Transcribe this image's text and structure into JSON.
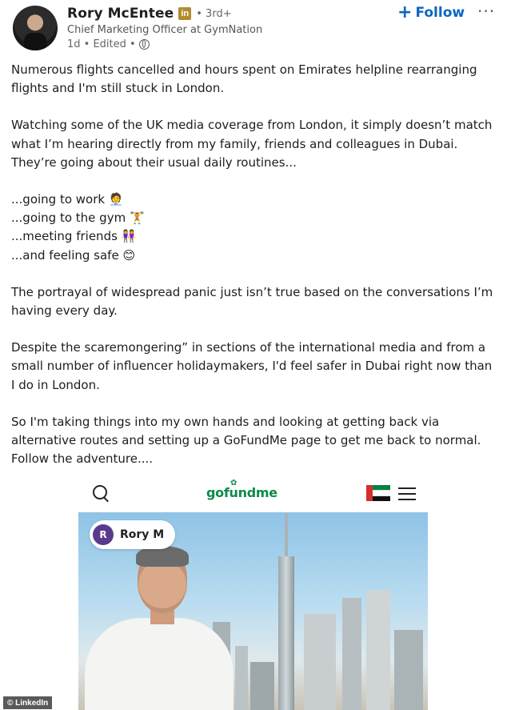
{
  "author": {
    "name": "Rory McEntee",
    "badge": "in",
    "degree": "• 3rd+",
    "headline": "Chief Marketing Officer at GymNation",
    "meta": "1d • Edited •"
  },
  "actions": {
    "follow_label": "Follow",
    "more_label": "···"
  },
  "post": {
    "p1": "Numerous flights cancelled and hours spent on Emirates helpline rearranging flights and I'm still stuck in London.",
    "p2": "Watching some of the UK media coverage from London, it simply doesn’t match what I’m hearing directly from my family, friends and colleagues in Dubai. They’re going about their usual daily routines...",
    "list": [
      "...going to work 🧑‍💼",
      "...going to the gym 🏋️",
      "...meeting friends 👭",
      "...and feeling safe 😊"
    ],
    "p3": "The portrayal of widespread panic just isn’t true based on the conversations I’m having every day.",
    "p4": "Despite the scaremongering” in sections of the international media and from a small number of influencer holidaymakers, I'd feel safer in Dubai right now than I do in London.",
    "p5": "So I'm taking things into my own hands and looking at getting back via alternative routes and setting up a GoFundMe page to get me back to normal. Follow the adventure...."
  },
  "embed": {
    "logo": "gofundme",
    "chip_initial": "R",
    "chip_name": "Rory M"
  },
  "watermark": "© LinkedIn",
  "colors": {
    "follow": "#0a66c2",
    "gofundme_green": "#0e8a4a"
  }
}
